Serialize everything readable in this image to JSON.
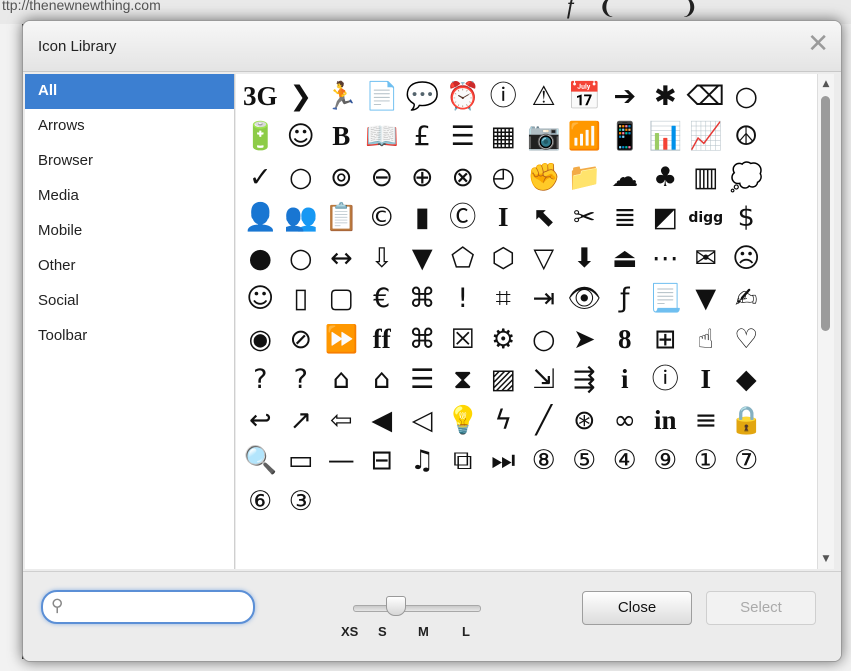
{
  "background": {
    "url": "ttp://thenewnewthing.com"
  },
  "dialog": {
    "title": "Icon Library",
    "close_glyph": "✕"
  },
  "categories": [
    "All",
    "Arrows",
    "Browser",
    "Media",
    "Mobile",
    "Other",
    "Social",
    "Toolbar"
  ],
  "selected_category": "All",
  "icons": [
    "3G",
    "❯",
    "🏃",
    "📄",
    "💬",
    "⏰",
    "ⓘ",
    "⚠",
    "📅",
    "➔",
    "✱",
    "⌫",
    "○",
    "🔋",
    "☺",
    "B",
    "📖",
    "£",
    "☰",
    "▦",
    "📷",
    "📶",
    "📱",
    "📊",
    "📈",
    "☮",
    "✓",
    "○",
    "⊚",
    "⊖",
    "⊕",
    "⊗",
    "◴",
    "✊",
    "📁",
    "☁",
    "♣",
    "▥",
    "💭",
    "👤",
    "👥",
    "📋",
    "©",
    "▮",
    "Ⓒ",
    "I",
    "⬉",
    "✂",
    "≣",
    "◩",
    "digg",
    "$",
    "●",
    "○",
    "↔",
    "⇩",
    "▼",
    "⬠",
    "⬡",
    "▽",
    "⬇",
    "⏏",
    "⋯",
    "✉",
    "☹",
    "☺",
    "▯",
    "▢",
    "€",
    "⌘",
    "!",
    "⌗",
    "⇥",
    "👁",
    "ƒ",
    "📃",
    "▼",
    "✍",
    "◉",
    "⊘",
    "⏩",
    "ff",
    "⌘",
    "☒",
    "⚙",
    "○",
    "➤",
    "8",
    "⊞",
    "☝",
    "♡",
    "?",
    "?",
    "⌂",
    "⌂",
    "☰",
    "⧗",
    "▨",
    "⇲",
    "⇶",
    "i",
    "ⓘ",
    "I",
    "◆",
    "↩",
    "↗",
    "⇦",
    "◀",
    "◁",
    "💡",
    "ϟ",
    "╱",
    "⊛",
    "∞",
    "in",
    "≡",
    "🔒",
    "🔍",
    "▭",
    "—",
    "⊟",
    "♫",
    "⧉",
    "⏭",
    "⑧",
    "⑤",
    "④",
    "⑨",
    "①",
    "⑦",
    "⑥",
    "③"
  ],
  "search": {
    "placeholder": "",
    "value": ""
  },
  "size_slider": {
    "labels": [
      "XS",
      "S",
      "M",
      "L"
    ],
    "selected": "S"
  },
  "buttons": {
    "close_label": "Close",
    "select_label": "Select",
    "select_enabled": false
  },
  "colors": {
    "selected_category_bg": "#3c7fd1",
    "search_focus_border": "#5b8fd6"
  }
}
